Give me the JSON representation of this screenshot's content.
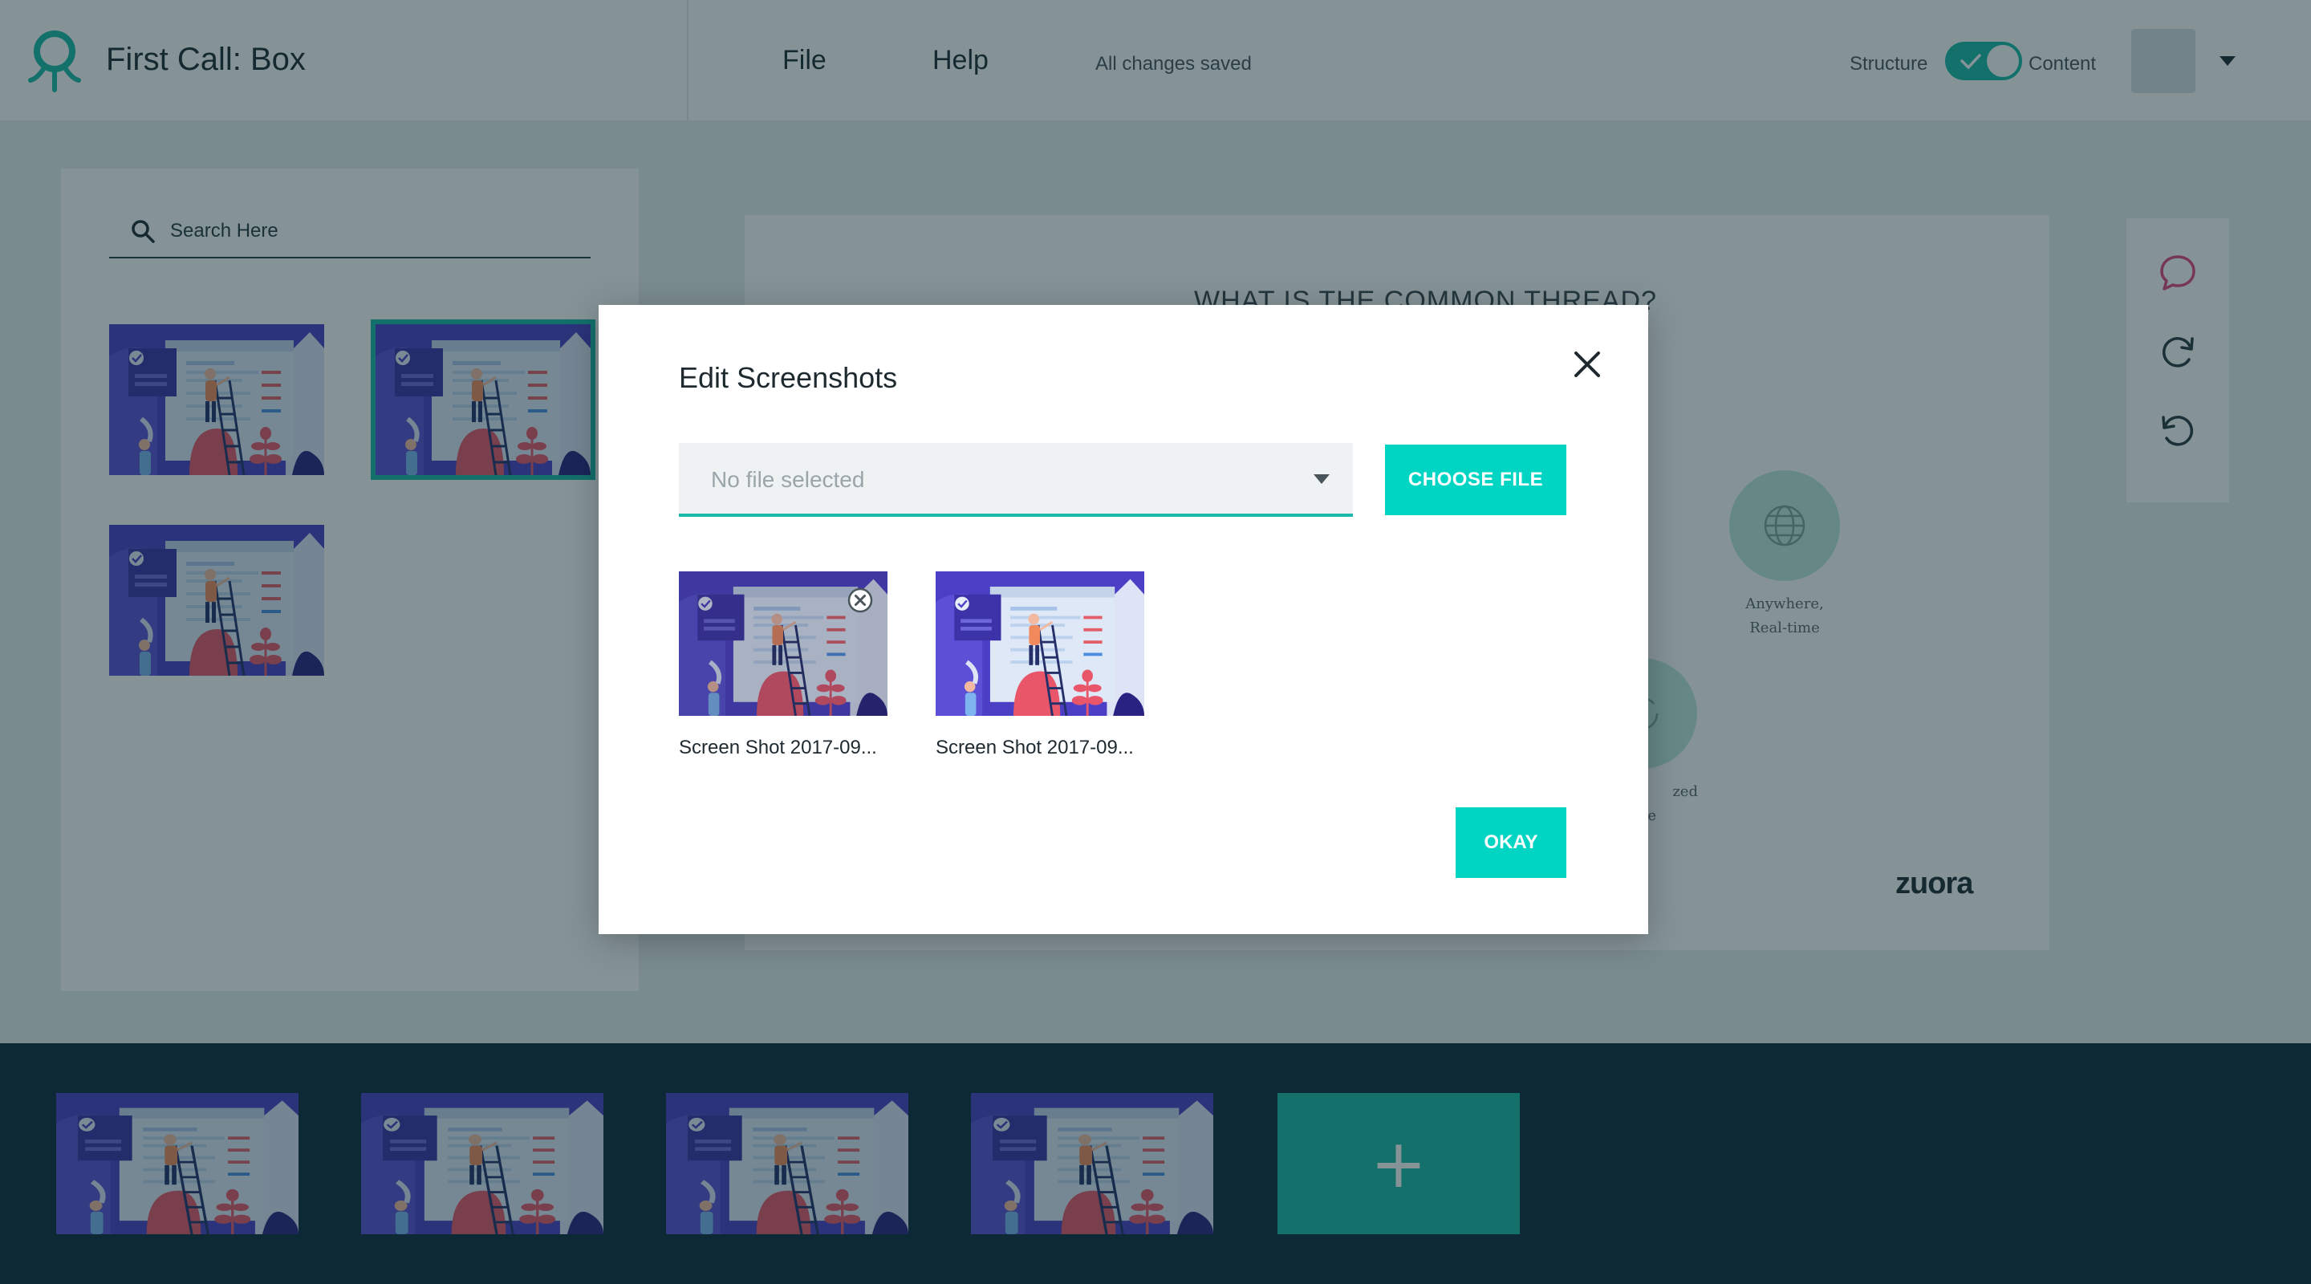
{
  "app": {
    "title": "First Call: Box",
    "logo_icon": "octopus-logo-icon",
    "accent": "#1ab8a6"
  },
  "menu": {
    "file": "File",
    "help": "Help",
    "status": "All changes saved"
  },
  "view_toggle": {
    "left_label": "Structure",
    "right_label": "Content",
    "state": "on"
  },
  "account": {
    "caret_icon": "caret-down-icon"
  },
  "search": {
    "placeholder": "Search Here",
    "icon": "search-icon"
  },
  "library": {
    "thumbnails": [
      {
        "selected": false
      },
      {
        "selected": true
      },
      {
        "selected": false
      }
    ]
  },
  "slide": {
    "heading": "WHAT IS THE COMMON THREAD?",
    "features": [
      {
        "icon": "globe-icon",
        "line1": "Anywhere,",
        "line2": "Real-time"
      },
      {
        "icon": "sync-icon",
        "line1": "zed",
        "line2": "e"
      }
    ],
    "brand": "zuora"
  },
  "tools": [
    {
      "icon": "comment-icon",
      "color": "#e0457b"
    },
    {
      "icon": "redo-icon",
      "color": "#2b3a40"
    },
    {
      "icon": "undo-icon",
      "color": "#2b3a40"
    }
  ],
  "filmstrip": {
    "slide_count": 4,
    "add_label": "+"
  },
  "modal": {
    "title": "Edit Screenshots",
    "close_icon": "close-icon",
    "file_select": {
      "value": "No file selected",
      "caret_icon": "caret-down-icon"
    },
    "choose_button": "CHOOSE FILE",
    "screenshots": [
      {
        "caption": "Screen Shot 2017-09...",
        "remove_icon": "remove-icon"
      },
      {
        "caption": "Screen Shot 2017-09..."
      }
    ],
    "okay_button": "OKAY"
  }
}
